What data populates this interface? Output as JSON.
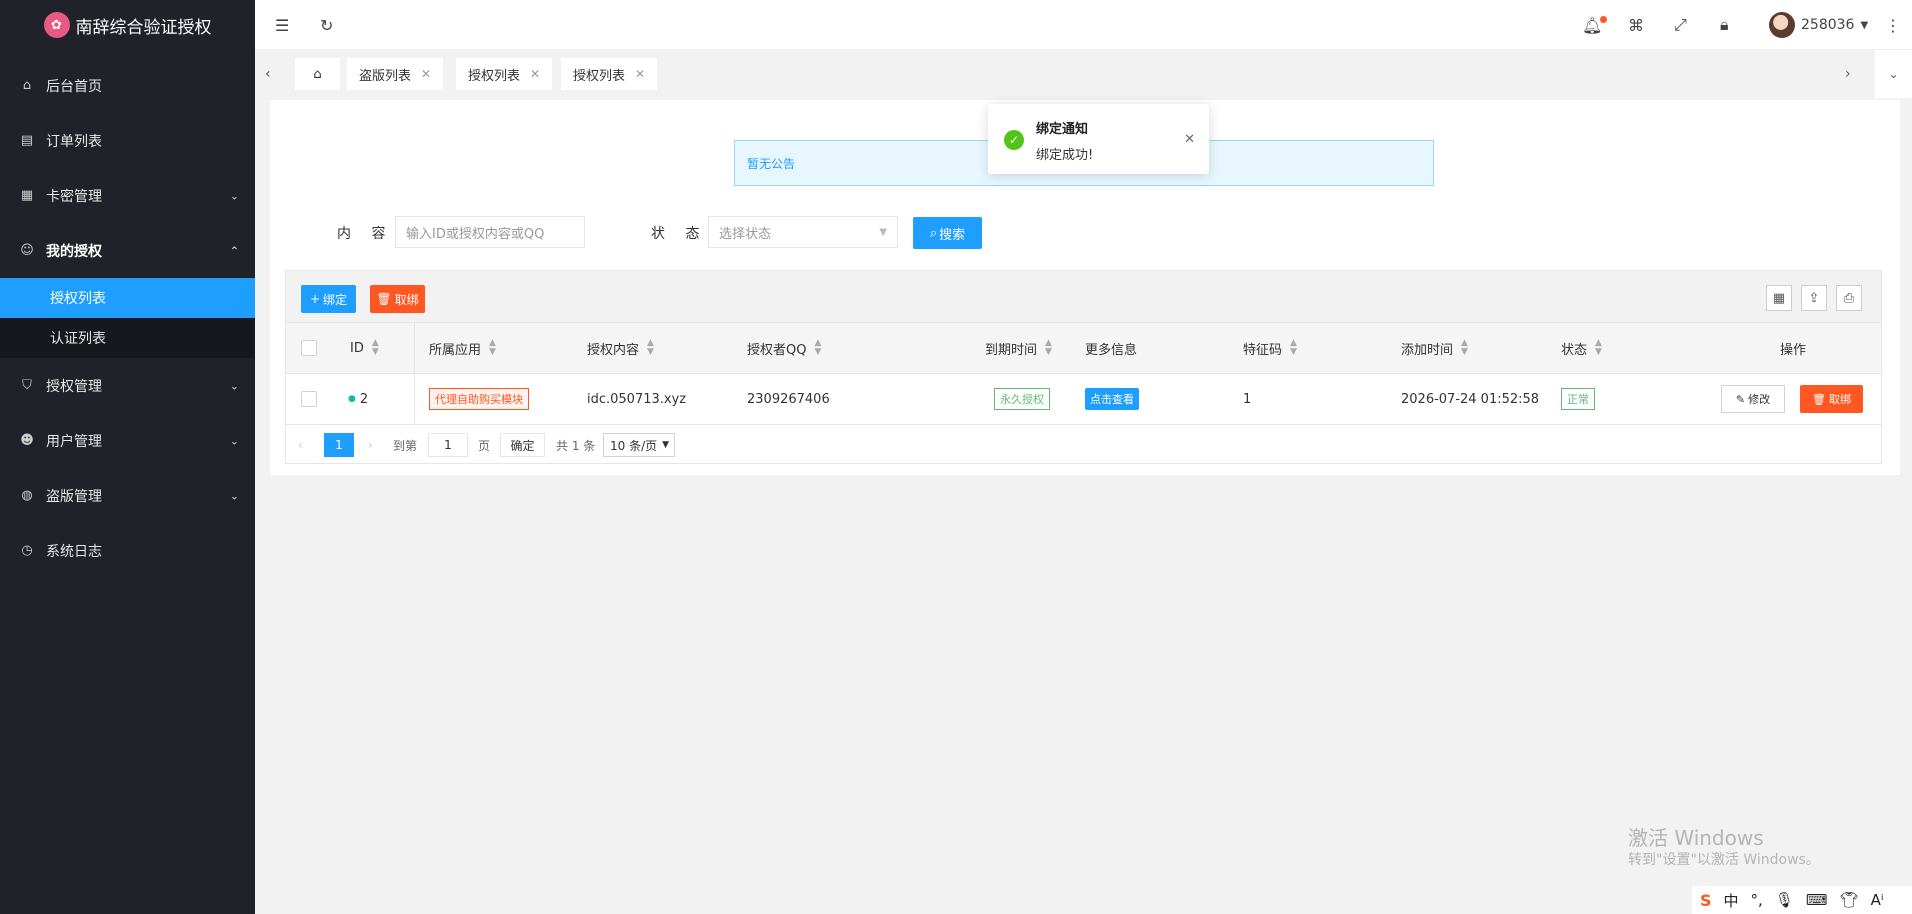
{
  "app": {
    "title": "南辞综合验证授权",
    "logo_icon": "lotus-icon",
    "accent": "#1e9fff",
    "danger": "#ff5722",
    "sidebar_bg": "#20222a"
  },
  "sidebar": {
    "items": [
      {
        "label": "后台首页",
        "icon": "home-icon"
      },
      {
        "label": "订单列表",
        "icon": "document-icon"
      },
      {
        "label": "卡密管理",
        "icon": "grid-icon"
      },
      {
        "label": "我的授权",
        "icon": "smile-icon"
      },
      {
        "label": "授权管理",
        "icon": "shield-icon"
      },
      {
        "label": "用户管理",
        "icon": "user-icon"
      },
      {
        "label": "盗版管理",
        "icon": "globe-icon"
      },
      {
        "label": "系统日志",
        "icon": "clock-icon"
      }
    ],
    "subitems": [
      {
        "label": "授权列表",
        "active": true
      },
      {
        "label": "认证列表",
        "active": false
      }
    ]
  },
  "header": {
    "username": "258036"
  },
  "tabs": [
    {
      "label": "盗版列表"
    },
    {
      "label": "授权列表"
    },
    {
      "label": "授权列表"
    }
  ],
  "notice": {
    "text": "暂无公告"
  },
  "toast": {
    "title": "绑定通知",
    "body": "绑定成功!"
  },
  "filter": {
    "content_label": "内 容",
    "content_placeholder": "输入ID或授权内容或QQ",
    "status_label": "状 态",
    "status_placeholder": "选择状态",
    "search_label": "搜索"
  },
  "toolbar": {
    "bind_label": "绑定",
    "unbind_label": "取绑"
  },
  "table": {
    "columns": [
      "ID",
      "所属应用",
      "授权内容",
      "授权者QQ",
      "到期时间",
      "更多信息",
      "特征码",
      "添加时间",
      "状态",
      "操作"
    ],
    "rows": [
      {
        "id": "2",
        "app": "代理自助购买模块",
        "content": "idc.050713.xyz",
        "qq": "2309267406",
        "expire": "永久授权",
        "more": "点击查看",
        "feature": "1",
        "added": "2026-07-24 01:52:58",
        "status": "正常",
        "edit_label": "修改",
        "unbind_label": "取绑"
      }
    ]
  },
  "pager": {
    "current": "1",
    "goto_label": "到第",
    "goto_value": "1",
    "page_label": "页",
    "confirm_label": "确定",
    "total_label": "共 1 条",
    "per_page": "10 条/页"
  },
  "watermark": {
    "line1": "激活 Windows",
    "line2": "转到\"设置\"以激活 Windows。"
  },
  "taskbar": {
    "ime": "中"
  }
}
